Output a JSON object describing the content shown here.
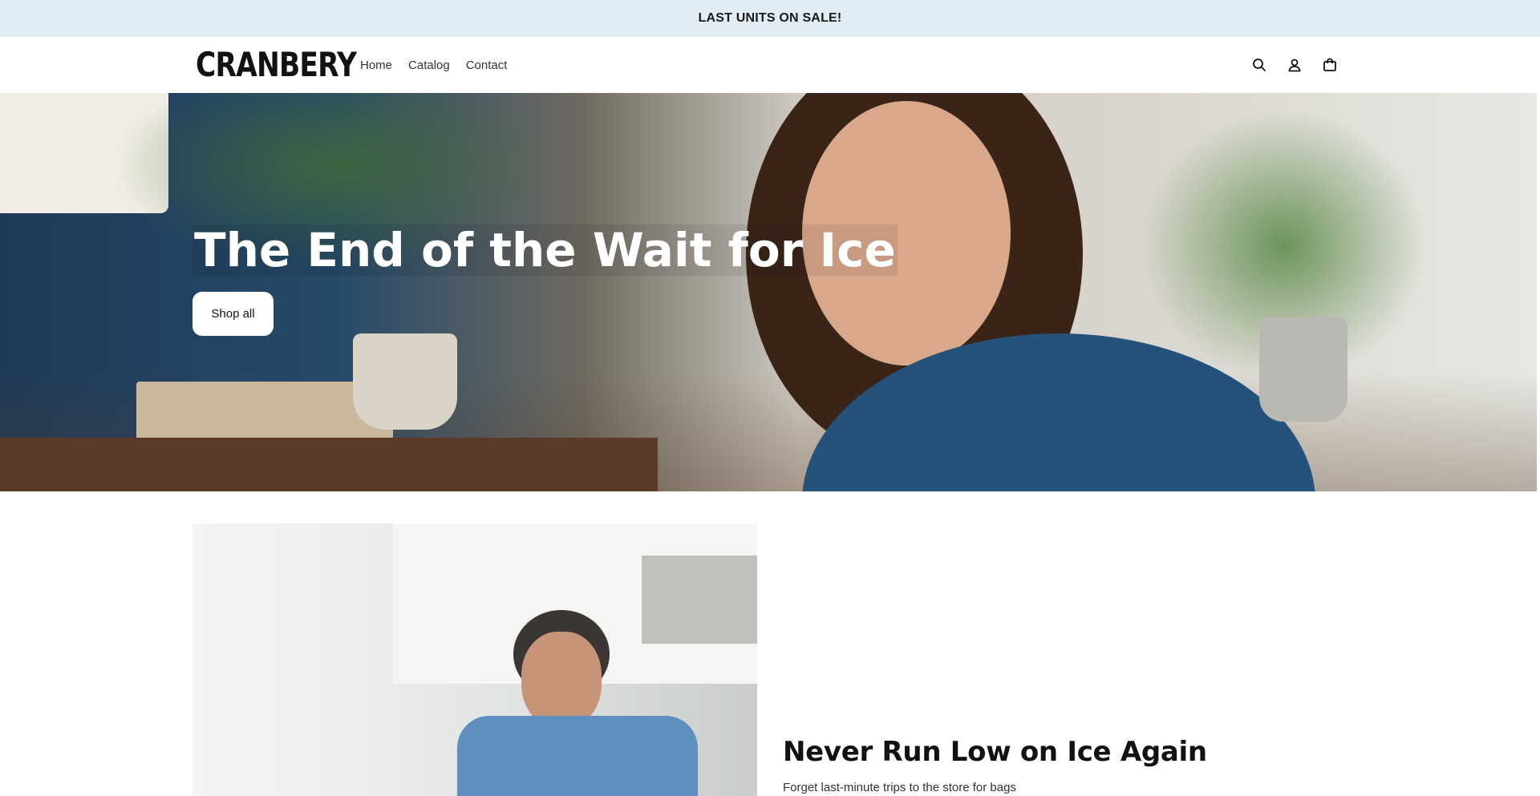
{
  "announcement": {
    "text": "LAST UNITS ON SALE!"
  },
  "header": {
    "logo_text": "CRANBERY",
    "nav": [
      {
        "label": "Home"
      },
      {
        "label": "Catalog"
      },
      {
        "label": "Contact"
      }
    ],
    "icons": [
      "search-icon",
      "account-icon",
      "cart-icon"
    ]
  },
  "hero": {
    "title": "The End of the Wait for Ice",
    "button_label": "Shop all"
  },
  "feature": {
    "title": "Never Run Low on Ice Again",
    "text": "Forget last-minute trips to the store for bags"
  },
  "colors": {
    "announcement_bg": "#e1ecf4",
    "text": "#121212",
    "button_bg": "#ffffff"
  }
}
